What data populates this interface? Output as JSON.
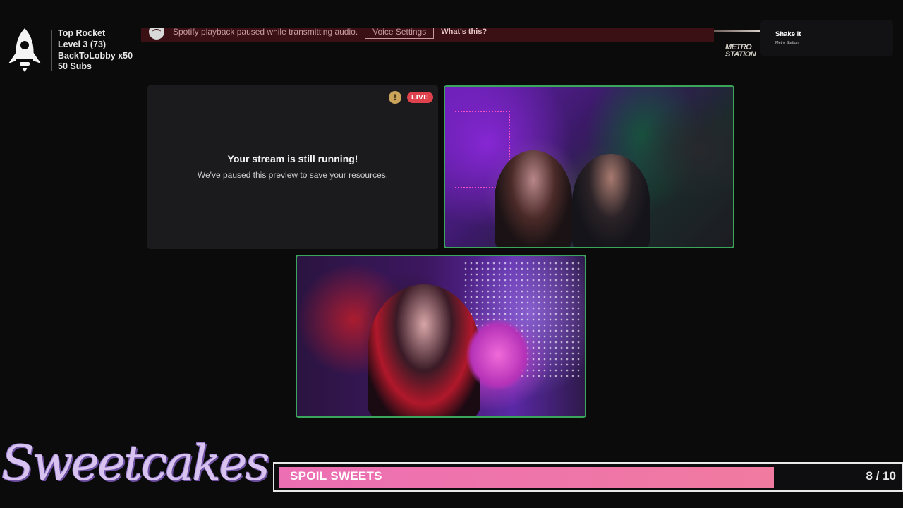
{
  "stats": {
    "line1": "Top Rocket",
    "line2": "Level 3  (73)",
    "line3": "BackToLobby x50",
    "line4": "50 Subs"
  },
  "spotify_banner": {
    "message": "Spotify playback paused while transmitting audio.",
    "button_label": "Voice Settings",
    "link_label": "What's this?",
    "background": "#3a1014"
  },
  "now_playing": {
    "art_logo_line1": "METRO",
    "art_logo_line2": "STATION",
    "title": "Shake It",
    "artist": "Metro Station"
  },
  "stream_preview": {
    "warning_icon": "!",
    "live_badge": "LIVE",
    "title": "Your stream is still running!",
    "subtitle": "We've paused this preview to save your resources."
  },
  "video_tiles": {
    "border_color": "#3ba55c"
  },
  "branding": {
    "name": "Sweetcakes"
  },
  "goal": {
    "label": "SPOIL SWEETS",
    "count_text": "8 / 10",
    "current": 8,
    "target": 10,
    "fill_color": "#ec6fb4"
  }
}
